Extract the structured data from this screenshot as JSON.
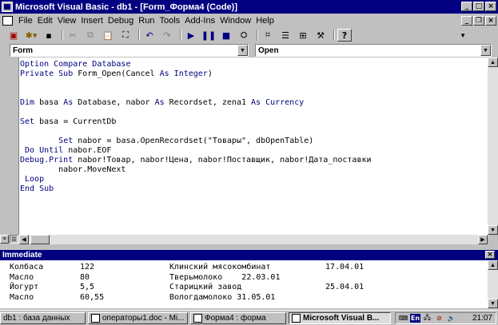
{
  "window": {
    "title": "Microsoft Visual Basic - db1 - [Form_Форма4 (Code)]"
  },
  "menu": {
    "items": [
      "File",
      "Edit",
      "View",
      "Insert",
      "Debug",
      "Run",
      "Tools",
      "Add-Ins",
      "Window",
      "Help"
    ]
  },
  "toolbar": {
    "icons": [
      "access-icon",
      "insert-module-icon",
      "save-icon",
      "cut-icon",
      "copy-icon",
      "paste-icon",
      "find-icon",
      "undo-icon",
      "redo-icon",
      "run-icon",
      "break-icon",
      "reset-icon",
      "design-mode-icon",
      "project-explorer-icon",
      "properties-icon",
      "object-browser-icon",
      "toolbox-icon",
      "help-icon"
    ]
  },
  "combos": {
    "object": "Form",
    "procedure": "Open"
  },
  "code": {
    "lines": [
      [
        {
          "t": "Option Compare Database",
          "k": true
        }
      ],
      [
        {
          "t": "Private Sub ",
          "k": true
        },
        {
          "t": "Form_Open(Cancel ",
          "k": false
        },
        {
          "t": "As Integer",
          "k": true
        },
        {
          "t": ")",
          "k": false
        }
      ],
      [
        {
          "t": "",
          "k": false
        }
      ],
      [
        {
          "t": "",
          "k": false
        }
      ],
      [
        {
          "t": "Dim ",
          "k": true
        },
        {
          "t": "basa ",
          "k": false
        },
        {
          "t": "As ",
          "k": true
        },
        {
          "t": "Database, nabor ",
          "k": false
        },
        {
          "t": "As ",
          "k": true
        },
        {
          "t": "Recordset, zena1 ",
          "k": false
        },
        {
          "t": "As Currency",
          "k": true
        }
      ],
      [
        {
          "t": "",
          "k": false
        }
      ],
      [
        {
          "t": "Set ",
          "k": true
        },
        {
          "t": "basa = CurrentDb",
          "k": false
        }
      ],
      [
        {
          "t": "",
          "k": false
        }
      ],
      [
        {
          "t": "        ",
          "k": false
        },
        {
          "t": "Set ",
          "k": true
        },
        {
          "t": "nabor = basa.OpenRecordset(\"Товары\", dbOpenTable)",
          "k": false
        }
      ],
      [
        {
          "t": " Do Until ",
          "k": true
        },
        {
          "t": "nabor.EOF",
          "k": false
        }
      ],
      [
        {
          "t": "Debug.Print ",
          "k": true
        },
        {
          "t": "nabor!Товар, nabor!Цена, nabor!Поставщик, nabor!Дата_поставки",
          "k": false
        }
      ],
      [
        {
          "t": "        nabor.MoveNext",
          "k": false
        }
      ],
      [
        {
          "t": " Loop",
          "k": true
        }
      ],
      [
        {
          "t": "End Sub",
          "k": true
        }
      ]
    ]
  },
  "immediate": {
    "title": "Immediate",
    "rows": [
      [
        "Колбаса",
        "122",
        "Клинский мясокомбинат",
        "17.04.01"
      ],
      [
        "Масло",
        "80",
        "Тверьмолоко    22.03.01",
        ""
      ],
      [
        "Йогурт",
        "5,5",
        "Старицкий завод",
        "25.04.01"
      ],
      [
        "Масло",
        "60,55",
        "Вологдамолоко 31.05.01",
        ""
      ]
    ]
  },
  "taskbar": {
    "tasks": [
      {
        "label": "db1 : база данных",
        "active": false
      },
      {
        "label": "операторы1.doc - Mi...",
        "active": false
      },
      {
        "label": "Форма4 : форма",
        "active": false
      },
      {
        "label": "Microsoft Visual B...",
        "active": true
      }
    ],
    "lang": "En",
    "clock": "21:07"
  }
}
